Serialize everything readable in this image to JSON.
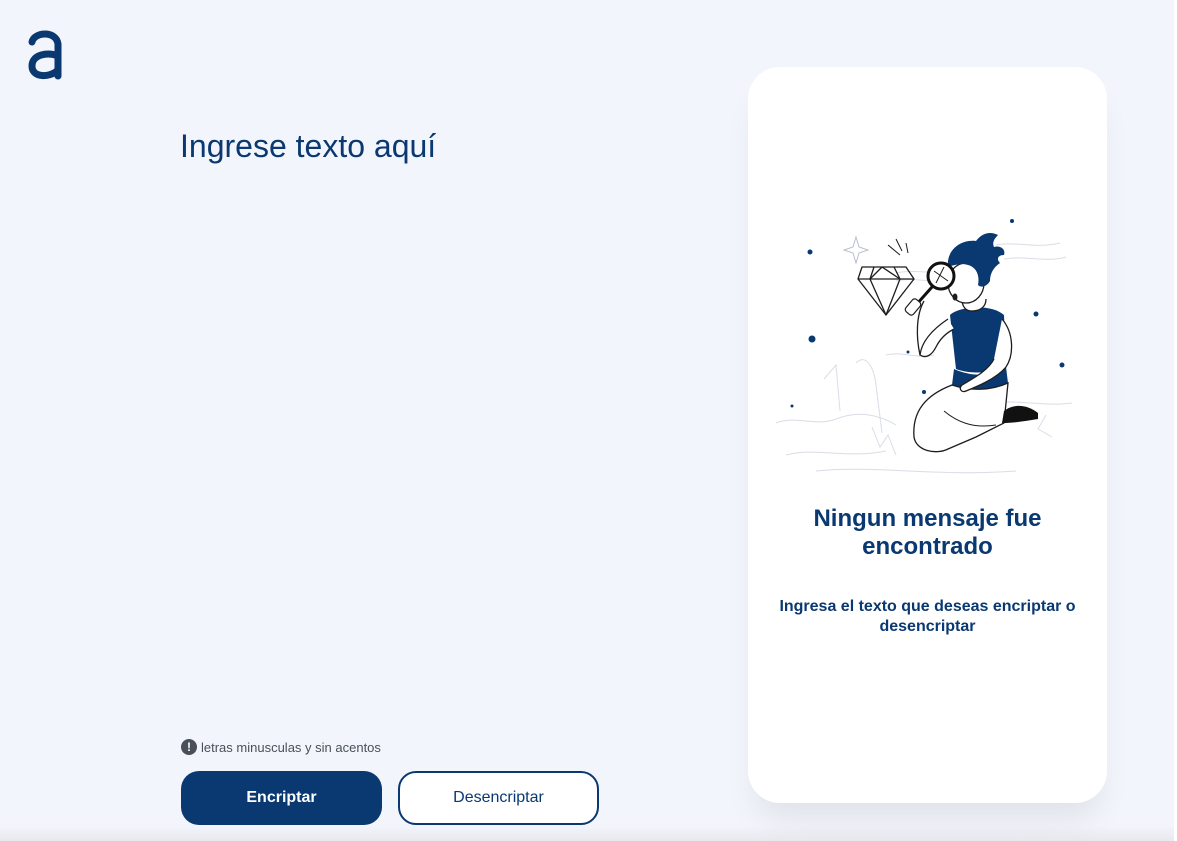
{
  "brand": {
    "logo_icon": "alura-a-logo-icon",
    "color": "#0a3871"
  },
  "input": {
    "placeholder": "Ingrese texto aquí",
    "value": ""
  },
  "hint": {
    "icon": "exclamation-circle-icon",
    "text": "letras minusculas y sin acentos"
  },
  "buttons": {
    "encrypt_label": "Encriptar",
    "decrypt_label": "Desencriptar"
  },
  "output_card": {
    "illustration_icon": "person-with-magnifying-glass-icon",
    "title": "Ningun mensaje fue encontrado",
    "subtitle": "Ingresa el texto que deseas encriptar o desencriptar"
  },
  "colors": {
    "background": "#f3f5fc",
    "primary": "#0a3871",
    "card": "#ffffff",
    "hint_text": "#495057"
  }
}
